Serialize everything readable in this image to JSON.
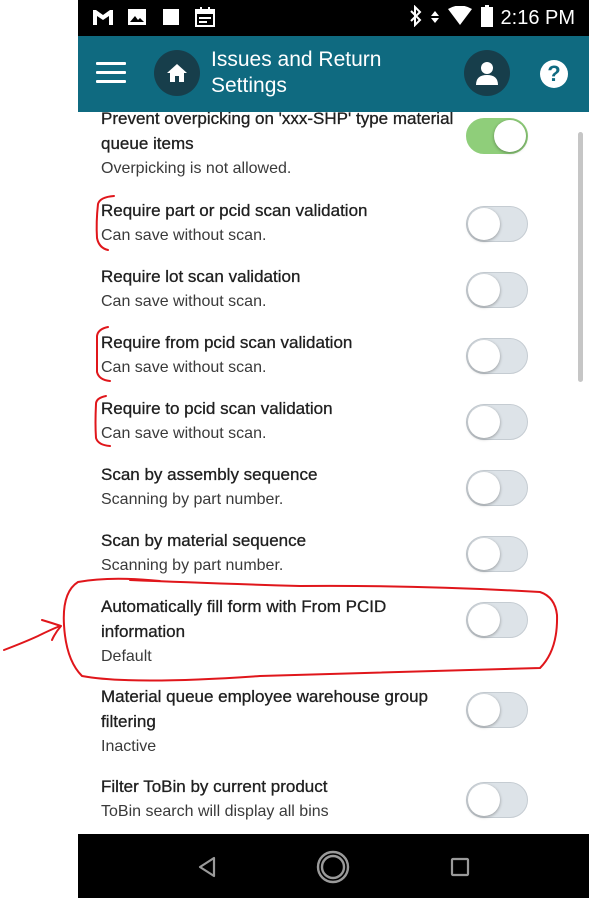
{
  "status_bar": {
    "time": "2:16 PM",
    "left_icons": [
      "gmail-icon",
      "image-icon",
      "square-icon",
      "calendar-icon"
    ],
    "right_icons": [
      "bluetooth-icon",
      "data-arrows-icon",
      "wifi-icon",
      "battery-icon"
    ]
  },
  "app_bar": {
    "title": "Issues and Return Settings",
    "color": "#0f6a80"
  },
  "settings": [
    {
      "label": "Prevent overpicking on 'xxx-SHP' type material queue items",
      "sub": "Overpicking is not allowed.",
      "on": true
    },
    {
      "label": "Require part or pcid scan validation",
      "sub": "Can save without scan.",
      "on": false
    },
    {
      "label": "Require lot scan validation",
      "sub": "Can save without scan.",
      "on": false
    },
    {
      "label": "Require from pcid scan validation",
      "sub": "Can save without scan.",
      "on": false
    },
    {
      "label": "Require to pcid scan validation",
      "sub": "Can save without scan.",
      "on": false
    },
    {
      "label": "Scan by assembly sequence",
      "sub": "Scanning by part number.",
      "on": false
    },
    {
      "label": "Scan by material sequence",
      "sub": "Scanning by part number.",
      "on": false
    },
    {
      "label": "Automatically fill form with From PCID information",
      "sub": "Default",
      "on": false
    },
    {
      "label": "Material queue employee warehouse group filtering",
      "sub": "Inactive",
      "on": false
    },
    {
      "label": "Filter ToBin by current product",
      "sub": "ToBin search will display all bins",
      "on": false
    }
  ],
  "colors": {
    "toggle_on": "#8fce7a",
    "toggle_off": "#dde3e8",
    "annotation": "#e0161b"
  }
}
